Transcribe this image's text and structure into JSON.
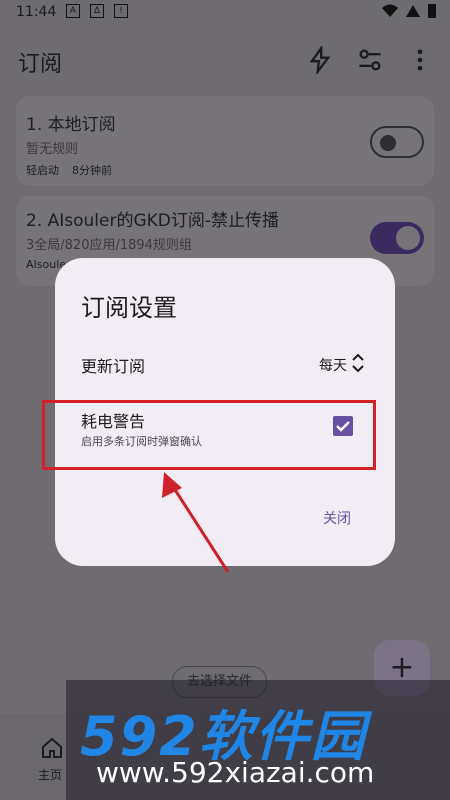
{
  "status_bar": {
    "time": "11:44",
    "left_icons": [
      "A",
      "∆",
      "!"
    ]
  },
  "app_bar": {
    "title": "订阅",
    "icons": [
      "bolt-icon",
      "tune-icon",
      "more-vert-icon"
    ]
  },
  "subscriptions": [
    {
      "title": "1. 本地订阅",
      "subtitle": "暂无规则",
      "meta_left": "轻启动",
      "meta_right": "8分钟前",
      "enabled": false
    },
    {
      "title": "2. AIsouler的GKD订阅-禁止传播",
      "subtitle": "3全局/820应用/1894规则组",
      "meta_left": "AIsouler",
      "enabled": true
    }
  ],
  "choose_file": "去选择文件",
  "fab": "+",
  "bottom_nav": {
    "home_label": "主页"
  },
  "dialog": {
    "title": "订阅设置",
    "update_label": "更新订阅",
    "update_value": "每天",
    "power_label": "耗电警告",
    "power_sub": "启用多条订阅时弹窗确认",
    "power_checked": true,
    "close_label": "关闭"
  },
  "watermark": {
    "brand": "592软件园",
    "url": "www.592xiazai.com"
  },
  "colors": {
    "accent": "#6750a4",
    "highlight": "#d0202a",
    "watermark_blue": "#1f86e6"
  }
}
